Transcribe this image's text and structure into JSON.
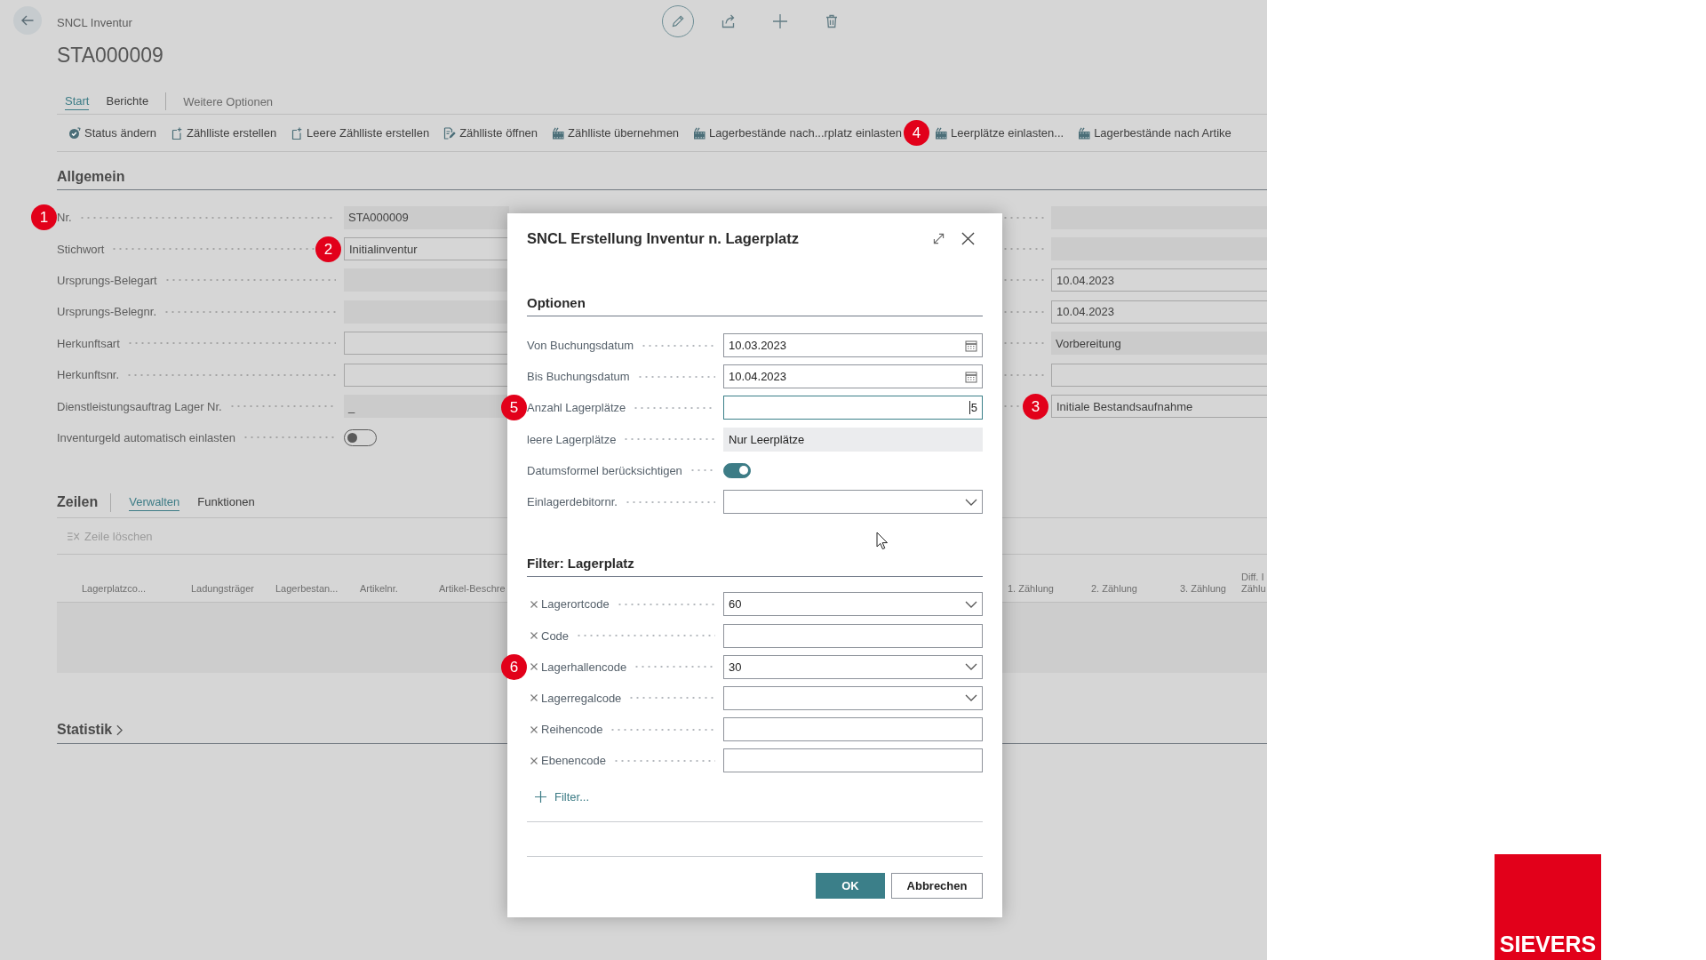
{
  "page": {
    "breadcrumb": "SNCL Inventur",
    "title": "STA000009",
    "tabs": [
      {
        "label": "Start",
        "selected": true
      },
      {
        "label": "Berichte",
        "selected": false
      }
    ],
    "more_options": "Weitere Optionen",
    "actions": [
      {
        "label": "Status ändern",
        "kind": "status"
      },
      {
        "label": "Zählliste erstellen",
        "kind": "new"
      },
      {
        "label": "Leere Zählliste erstellen",
        "kind": "new"
      },
      {
        "label": "Zählliste öffnen",
        "kind": "edit"
      },
      {
        "label": "Zählliste übernehmen",
        "kind": "load"
      },
      {
        "label": "Lagerbestände nach...rplatz einlasten",
        "kind": "load",
        "callout": {
          "number": "4",
          "kind": "after"
        }
      },
      {
        "label": "Leerplätze einlasten...",
        "kind": "load"
      },
      {
        "label": "Lagerbestände nach Artike",
        "kind": "load"
      }
    ]
  },
  "general": {
    "heading": "Allgemein",
    "left_fields": [
      {
        "label": "Nr.",
        "kind": "readonly",
        "value": "STA000009",
        "callout": {
          "number": "1",
          "kind": "label"
        }
      },
      {
        "label": "Stichwort",
        "kind": "input",
        "value": "Initialinventur",
        "callout": {
          "number": "2",
          "kind": "field"
        }
      },
      {
        "label": "Ursprungs-Belegart",
        "kind": "readonly"
      },
      {
        "label": "Ursprungs-Belegnr.",
        "kind": "readonly"
      },
      {
        "label": "Herkunftsart",
        "kind": "input"
      },
      {
        "label": "Herkunftsnr.",
        "kind": "input"
      },
      {
        "label": "Dienstleistungsauftrag Lager Nr.",
        "kind": "readonly",
        "value": "_"
      },
      {
        "label": "Inventurgeld automatisch einlasten",
        "kind": "toggle",
        "on": false
      }
    ],
    "right_fields": [
      {
        "kind": "readonly"
      },
      {
        "kind": "readonly"
      },
      {
        "kind": "input",
        "value": "10.04.2023"
      },
      {
        "kind": "input",
        "value": "10.04.2023"
      },
      {
        "kind": "readonly",
        "value": "Vorbereitung"
      },
      {
        "kind": "input"
      },
      {
        "kind": "input",
        "value": "Initiale Bestandsaufnahme",
        "callout": {
          "number": "3",
          "kind": "field"
        }
      }
    ]
  },
  "lines": {
    "heading": "Zeilen",
    "tabs": [
      {
        "label": "Verwalten",
        "selected": true
      },
      {
        "label": "Funktionen",
        "selected": false
      }
    ],
    "actions": [
      {
        "label": "Zeile löschen",
        "disabled": true
      }
    ],
    "columns": [
      "Lagerplatzco...",
      "Ladungsträger",
      "Lagerbestan...",
      "Artikelnr.",
      "Artikel-Beschre"
    ],
    "right_columns": [
      "1. Zählung",
      "2. Zählung",
      "3. Zählung",
      "Diff. I Zählu"
    ]
  },
  "statistics": {
    "heading": "Statistik"
  },
  "dialog": {
    "title": "SNCL Erstellung Inventur n. Lagerplatz",
    "sections": [
      {
        "heading": "Optionen",
        "kind": "options",
        "fields": [
          {
            "label": "Von Buchungsdatum",
            "kind": "date",
            "value": "10.03.2023",
            "focused": false
          },
          {
            "label": "Bis Buchungsdatum",
            "kind": "date",
            "value": "10.04.2023",
            "focused": false
          },
          {
            "label": "Anzahl Lagerplätze",
            "kind": "number",
            "value": "5",
            "focused": true,
            "callout": {
              "number": "5",
              "kind": "label"
            }
          },
          {
            "label": "leere Lagerplätze",
            "kind": "readonly",
            "value": "Nur Leerplätze",
            "focused": false
          },
          {
            "label": "Datumsformel berücksichtigen",
            "kind": "toggle",
            "on": true
          },
          {
            "label": "Einlagerdebitornr.",
            "kind": "dropdown",
            "focused": false
          }
        ]
      },
      {
        "heading": "Filter: Lagerplatz",
        "kind": "filter",
        "fields": [
          {
            "label": "Lagerortcode",
            "kind": "dropdown",
            "value": "60",
            "focused": false
          },
          {
            "label": "Code",
            "kind": "text",
            "focused": false
          },
          {
            "label": "Lagerhallencode",
            "kind": "dropdown",
            "value": "30",
            "focused": false,
            "callout": {
              "number": "6",
              "kind": "label"
            }
          },
          {
            "label": "Lagerregalcode",
            "kind": "dropdown",
            "focused": false
          },
          {
            "label": "Reihencode",
            "kind": "text",
            "focused": false
          },
          {
            "label": "Ebenencode",
            "kind": "text",
            "focused": false
          }
        ]
      }
    ],
    "add_filter": "Filter...",
    "buttons": [
      {
        "label": "OK",
        "kind": "primary"
      },
      {
        "label": "Abbrechen",
        "kind": "secondary"
      }
    ]
  },
  "logo": {
    "text": "SIEVERS"
  }
}
